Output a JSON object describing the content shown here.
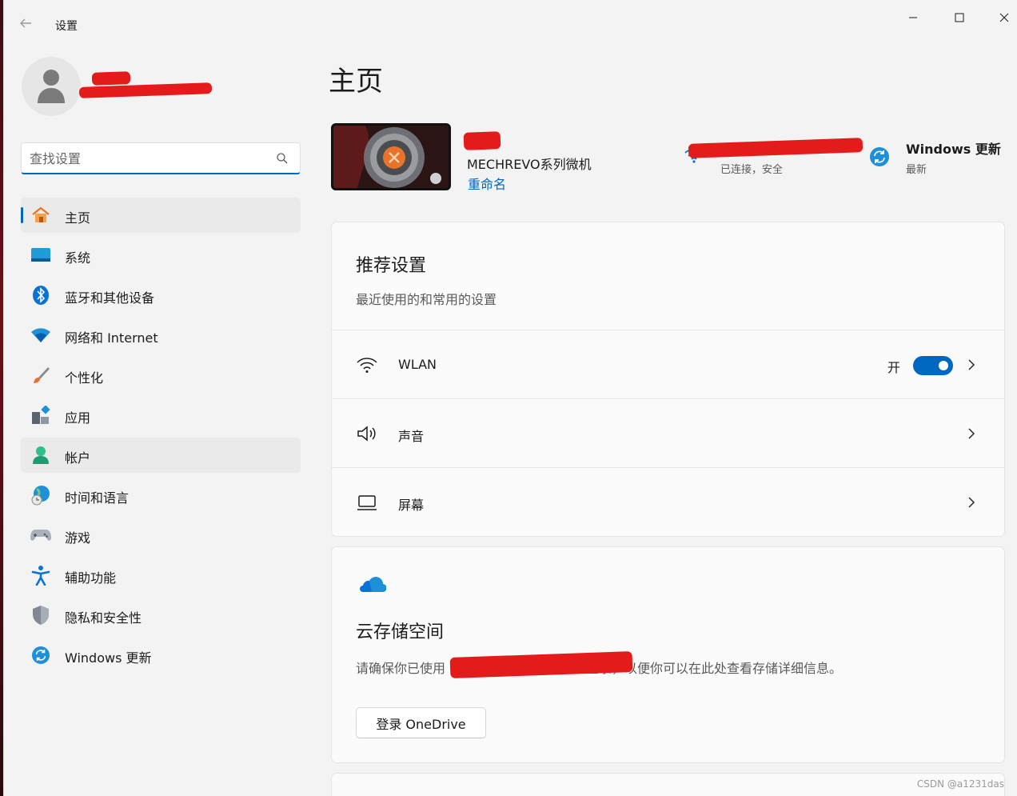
{
  "window": {
    "app_title": "设置",
    "user_name": "",
    "search_placeholder": "查找设置"
  },
  "sidebar": {
    "items": [
      {
        "label": "主页",
        "icon": "home-icon",
        "active": true
      },
      {
        "label": "系统",
        "icon": "system-icon"
      },
      {
        "label": "蓝牙和其他设备",
        "icon": "bluetooth-icon"
      },
      {
        "label": "网络和 Internet",
        "icon": "network-icon"
      },
      {
        "label": "个性化",
        "icon": "brush-icon"
      },
      {
        "label": "应用",
        "icon": "apps-icon"
      },
      {
        "label": "帐户",
        "icon": "account-icon",
        "hover": true
      },
      {
        "label": "时间和语言",
        "icon": "globe-clock-icon"
      },
      {
        "label": "游戏",
        "icon": "gamepad-icon"
      },
      {
        "label": "辅助功能",
        "icon": "accessibility-icon"
      },
      {
        "label": "隐私和安全性",
        "icon": "shield-icon"
      },
      {
        "label": "Windows 更新",
        "icon": "update-icon"
      }
    ]
  },
  "main": {
    "page_title": "主页",
    "device": {
      "model": "MECHREVO系列微机",
      "rename_label": "重命名"
    },
    "network": {
      "status": "已连接，安全"
    },
    "update": {
      "title": "Windows 更新",
      "status": "最新"
    },
    "recommended": {
      "title": "推荐设置",
      "subtitle": "最近使用的和常用的设置",
      "rows": [
        {
          "label": "WLAN",
          "icon": "wifi-icon",
          "toggle_label": "开",
          "toggle_on": true
        },
        {
          "label": "声音",
          "icon": "speaker-icon"
        },
        {
          "label": "屏幕",
          "icon": "laptop-icon"
        }
      ]
    },
    "cloud": {
      "title": "云存储空间",
      "desc_prefix": "请确保你已使用",
      "desc_suffix": "登录，以便你可以在此处查看存储详细信息。",
      "button_label": "登录 OneDrive"
    }
  },
  "watermark": "CSDN @a1231das",
  "colors": {
    "accent": "#0067c0",
    "background": "#f3f3f3",
    "card": "#fbfbfb",
    "redaction": "#e41b1b"
  }
}
